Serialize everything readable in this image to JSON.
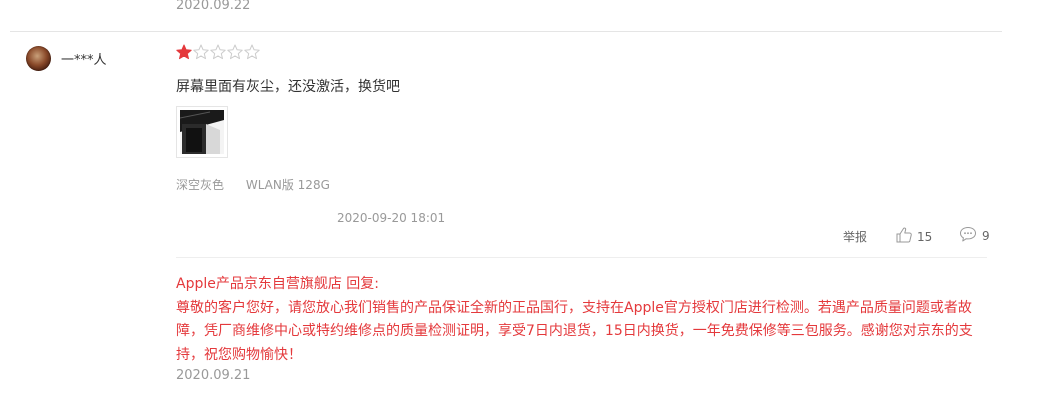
{
  "previous_review": {
    "date": "2020.09.22"
  },
  "review": {
    "username": "一***人",
    "rating": 1,
    "rating_max": 5,
    "text": "屏幕里面有灰尘，还没激活，换货吧",
    "specs": {
      "color": "深空灰色",
      "version": "WLAN版 128G"
    },
    "time": "2020-09-20 18:01",
    "report_label": "举报",
    "like_count": "15",
    "comment_count": "9"
  },
  "reply": {
    "author": "Apple产品京东自营旗舰店 回复:",
    "body": "尊敬的客户您好，请您放心我们销售的产品保证全新的正品国行，支持在Apple官方授权门店进行检测。若遇产品质量问题或者故障，凭厂商维修中心或特约维修点的质量检测证明，享受7日内退货，15日内换货，一年免费保修等三包服务。感谢您对京东的支持，祝您购物愉快！",
    "date": "2020.09.21"
  },
  "colors": {
    "star_filled": "#e4393c",
    "star_empty": "#cccccc",
    "reply_text": "#e4393c",
    "muted_text": "#999999"
  },
  "icons": {
    "like": "thumbs-up-icon",
    "comment": "comment-bubble-icon",
    "star": "star-icon"
  }
}
